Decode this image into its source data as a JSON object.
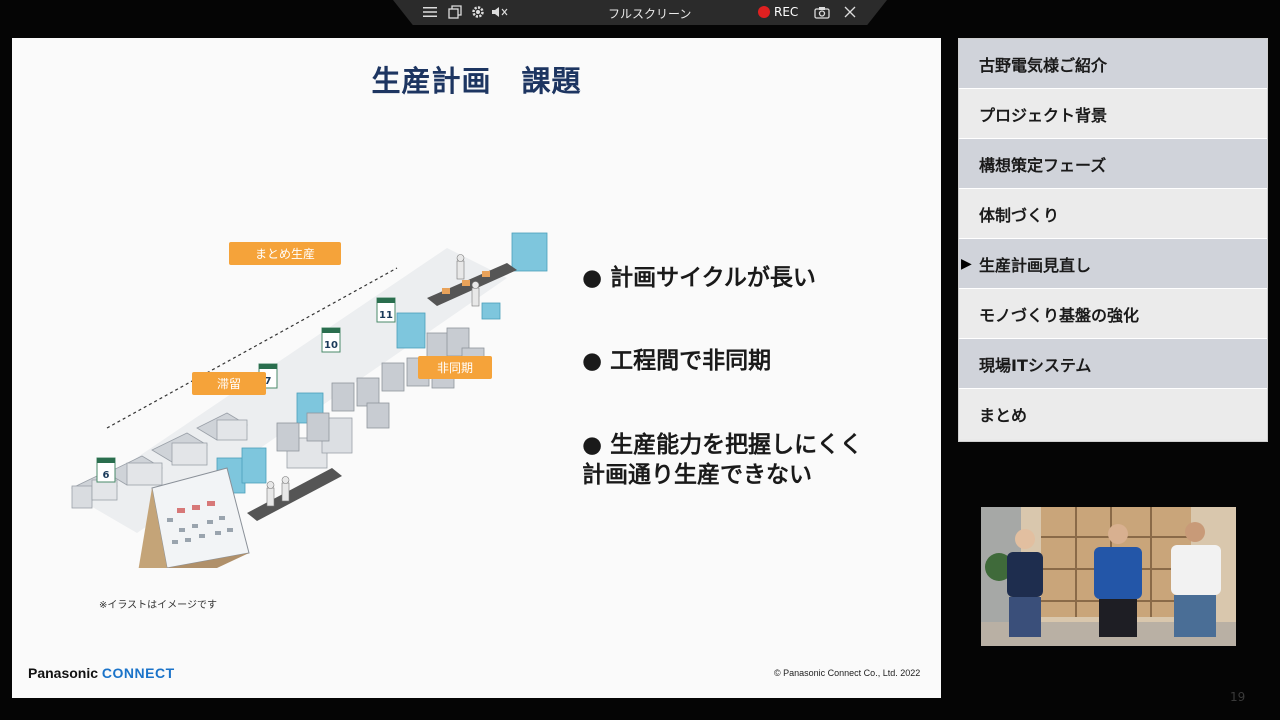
{
  "toolbar": {
    "title": "フルスクリーン",
    "rec_label": "REC",
    "icons": [
      "menu-icon",
      "window-icon",
      "gear-icon",
      "mute-icon",
      "camera-icon",
      "close-icon"
    ],
    "rec_color": "#e02020"
  },
  "slide": {
    "title": "生産計画　課題",
    "bullets": [
      "● 計画サイクルが長い",
      "● 工程間で非同期",
      "● 生産能力を把握しにくく",
      "計画通り生産できない"
    ],
    "tags": [
      "まとめ生産",
      "滞留",
      "非同期"
    ],
    "calendar_numbers": [
      "6",
      "7",
      "10",
      "11"
    ],
    "note": "※イラストはイメージです",
    "logo_part1": "Panasonic",
    "logo_part2": "CONNECT",
    "copyright": "© Panasonic Connect Co., Ltd. 2022",
    "accent_color": "#f5a33a",
    "title_color": "#1d3561"
  },
  "agenda": {
    "items": [
      {
        "label": "古野電気様ご紹介",
        "active": false
      },
      {
        "label": "プロジェクト背景",
        "active": false
      },
      {
        "label": "構想策定フェーズ",
        "active": false
      },
      {
        "label": "体制づくり",
        "active": false
      },
      {
        "label": "生産計画見直し",
        "active": true
      },
      {
        "label": "モノづくり基盤の強化",
        "active": false
      },
      {
        "label": "現場ITシステム",
        "active": false
      },
      {
        "label": "まとめ",
        "active": false
      }
    ],
    "active_marker": "▶"
  },
  "video": {
    "people": 3
  },
  "page_number": "19"
}
